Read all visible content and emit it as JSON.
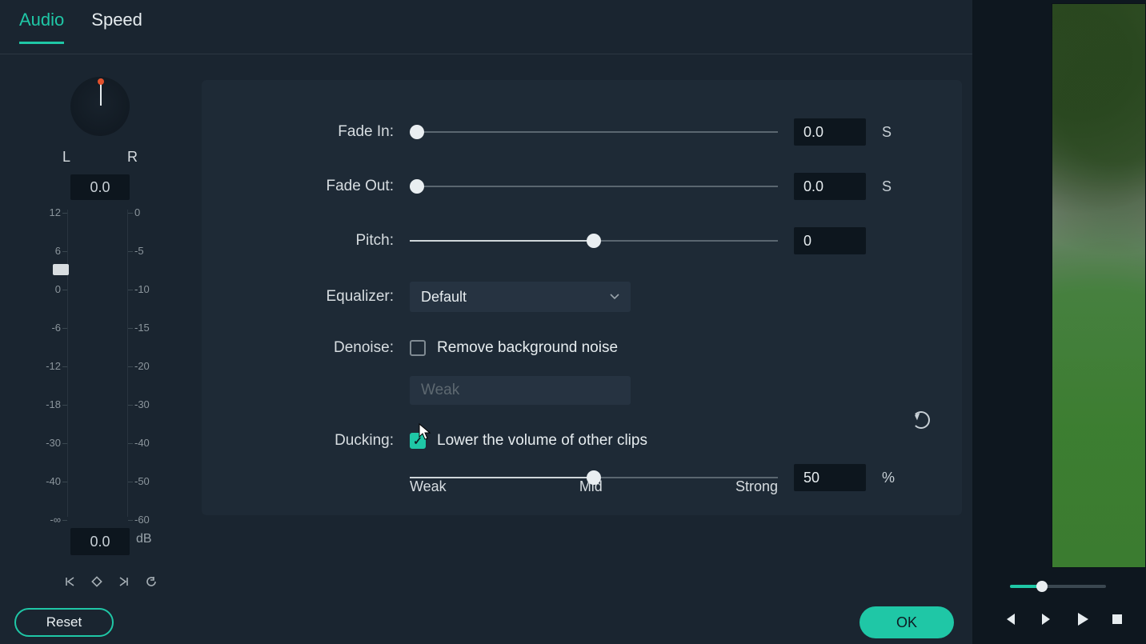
{
  "tabs": {
    "audio": "Audio",
    "speed": "Speed",
    "active": "audio"
  },
  "balance": {
    "left_label": "L",
    "right_label": "R",
    "pan_value": "0.0"
  },
  "volume_meter": {
    "left_ticks": [
      "12",
      "6",
      "0",
      "-6",
      "-12",
      "-18",
      "-30",
      "-40",
      "-∞"
    ],
    "right_ticks": [
      "0",
      "-5",
      "-10",
      "-15",
      "-20",
      "-30",
      "-40",
      "-50",
      "-60"
    ],
    "gain_value": "0.0",
    "db_unit": "dB"
  },
  "nav_icons": {
    "prev_key": "⤃",
    "keyframe": "◇",
    "next_key": "⤂",
    "reset": "↺"
  },
  "buttons": {
    "reset": "Reset",
    "ok": "OK"
  },
  "settings": {
    "fade_in": {
      "label": "Fade In:",
      "value": "0.0",
      "unit": "S",
      "pos": 0
    },
    "fade_out": {
      "label": "Fade Out:",
      "value": "0.0",
      "unit": "S",
      "pos": 0
    },
    "pitch": {
      "label": "Pitch:",
      "value": "0",
      "pos": 0.5
    },
    "equalizer": {
      "label": "Equalizer:",
      "value": "Default"
    },
    "denoise": {
      "label": "Denoise:",
      "checkbox_label": "Remove background noise",
      "checked": false,
      "strength": "Weak"
    },
    "ducking": {
      "label": "Ducking:",
      "checkbox_label": "Lower the volume of other clips",
      "checked": true,
      "value": "50",
      "unit": "%",
      "pos": 0.5,
      "scale": {
        "weak": "Weak",
        "mid": "Mid",
        "strong": "Strong"
      }
    }
  },
  "preview": {
    "zoom_pos": 0.33
  }
}
